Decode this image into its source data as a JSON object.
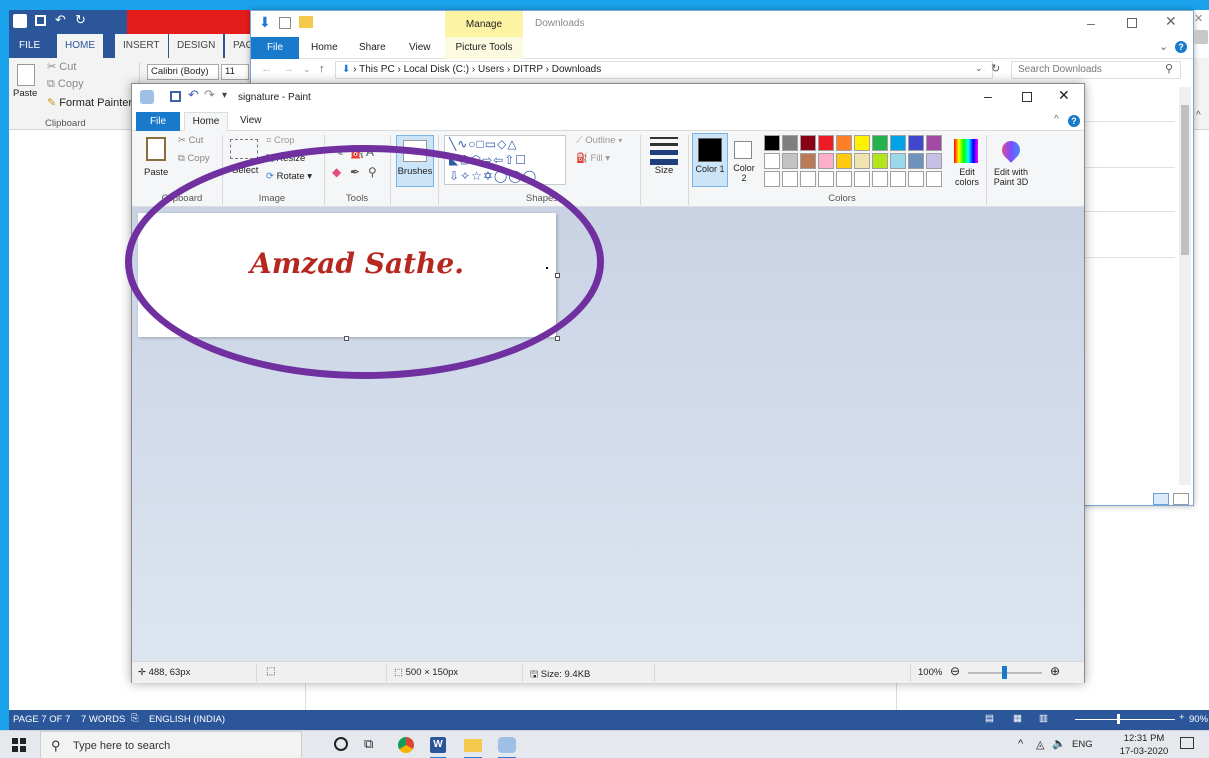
{
  "word": {
    "tabs": [
      "FILE",
      "HOME",
      "INSERT",
      "DESIGN",
      "PAG"
    ],
    "font_name": "Calibri (Body)",
    "font_size": "11",
    "clipboard": {
      "cut": "Cut",
      "copy": "Copy",
      "paste": "Paste",
      "format_painter": "Format Painter",
      "group": "Clipboard"
    },
    "status": {
      "page": "PAGE 7 OF 7",
      "words": "7 WORDS",
      "language": "ENGLISH (INDIA)",
      "zoom": "90%"
    }
  },
  "explorer": {
    "title": "Downloads",
    "context_tab": "Manage",
    "tabs": [
      "File",
      "Home",
      "Share",
      "View",
      "Picture Tools"
    ],
    "breadcrumb": [
      "This PC",
      "Local Disk (C:)",
      "Users",
      "DITRP",
      "Downloads"
    ],
    "search_placeholder": "Search Downloads"
  },
  "paint": {
    "title": "signature - Paint",
    "tabs": [
      "File",
      "Home",
      "View"
    ],
    "clipboard": {
      "paste": "Paste",
      "cut": "Cut",
      "copy": "Copy",
      "group": "Clipboard"
    },
    "image": {
      "select": "Select",
      "crop": "Crop",
      "resize": "Resize",
      "rotate": "Rotate",
      "group": "Image"
    },
    "tools_group": "Tools",
    "brushes": "Brushes",
    "shapes": {
      "outline": "Outline",
      "fill": "Fill",
      "group": "Shapes"
    },
    "size": "Size",
    "color1": "Color 1",
    "color2": "Color 2",
    "colors_group": "Colors",
    "edit_colors": "Edit colors",
    "edit_paint3d": "Edit with Paint 3D",
    "signature": "Amzad Sathe.",
    "status": {
      "cursor": "488, 63px",
      "dimensions": "500 × 150px",
      "size": "Size: 9.4KB",
      "zoom": "100%"
    },
    "palette_row1": [
      "#000000",
      "#7f7f7f",
      "#880015",
      "#ed1c24",
      "#ff7f27",
      "#fff200",
      "#22b14c",
      "#00a2e8",
      "#3f48cc",
      "#a349a4"
    ],
    "palette_row2": [
      "#ffffff",
      "#c3c3c3",
      "#b97a57",
      "#ffaec9",
      "#ffc90e",
      "#efe4b0",
      "#b5e61d",
      "#99d9ea",
      "#7092be",
      "#c8bfe7"
    ]
  },
  "taskbar": {
    "search_placeholder": "Type here to search",
    "time": "12:31 PM",
    "date": "17-03-2020",
    "lang": "ENG"
  },
  "colors": {
    "accent_purple": "#7030a0",
    "signature_red": "#b5271f",
    "word_blue": "#2b579a",
    "desktop_blue": "#1aa3ec"
  }
}
